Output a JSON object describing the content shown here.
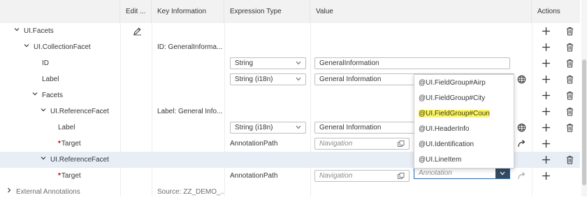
{
  "columns": {
    "edit": "Edit ...",
    "key_info": "Key Information",
    "expr_type": "Expression Type",
    "value": "Value",
    "actions": "Actions"
  },
  "rows": [
    {
      "label": "UI.Facets",
      "expander": "expanded",
      "key_info": "",
      "expr": "",
      "value": "",
      "edit_icon": "pencil-icon"
    },
    {
      "label": "UI.CollectionFacet",
      "expander": "expanded",
      "key_info": "ID: GeneralInforma...",
      "expr": "",
      "value": ""
    },
    {
      "label": "ID",
      "expander": "none",
      "key_info": "",
      "expr": "String",
      "value": "GeneralInformation"
    },
    {
      "label": "Label",
      "expander": "none",
      "key_info": "",
      "expr": "String (i18n)",
      "value": "General Information"
    },
    {
      "label": "Facets",
      "expander": "expanded",
      "key_info": "",
      "expr": "",
      "value": ""
    },
    {
      "label": "UI.ReferenceFacet",
      "expander": "expanded",
      "key_info": "Label: General Info...",
      "expr": "",
      "value": ""
    },
    {
      "label": "Label",
      "expander": "none",
      "key_info": "",
      "expr": "String (i18n)",
      "value": "General Information"
    },
    {
      "label": "Target",
      "expander": "none",
      "required": "*",
      "key_info": "",
      "expr": "AnnotationPath",
      "value_placeholder": "Navigation"
    },
    {
      "label": "UI.ReferenceFacet",
      "expander": "expanded",
      "key_info": "",
      "expr": "",
      "value": ""
    },
    {
      "label": "Target",
      "expander": "none",
      "required": "*",
      "key_info": "",
      "expr": "AnnotationPath",
      "value_placeholder": "Navigation"
    },
    {
      "label": "External Annotations",
      "expander": "collapsed",
      "key_info": "Source: ZZ_DEMO_...",
      "expr": "",
      "value": ""
    }
  ],
  "dropdown": {
    "options": [
      "@UI.FieldGroup#Airp",
      "@UI.FieldGroup#City",
      "@UI.FieldGroup#Coun",
      "@UI.HeaderInfo",
      "@UI.Identification",
      "@UI.LineItem"
    ],
    "highlighted": "@UI.FieldGroup#Coun"
  },
  "annotation_combo": {
    "placeholder": "Annotation"
  },
  "icons": {
    "add": "plus-icon",
    "delete": "trash-icon",
    "globe": "globe-icon",
    "value_help": "value-help-icon",
    "goto": "arrow-icon"
  },
  "colors": {
    "header_bg": "#f2f2f2",
    "selected_row": "#e8eef5",
    "accent": "#0a6ed1",
    "required": "#bb0000",
    "highlight": "#fff75a"
  }
}
